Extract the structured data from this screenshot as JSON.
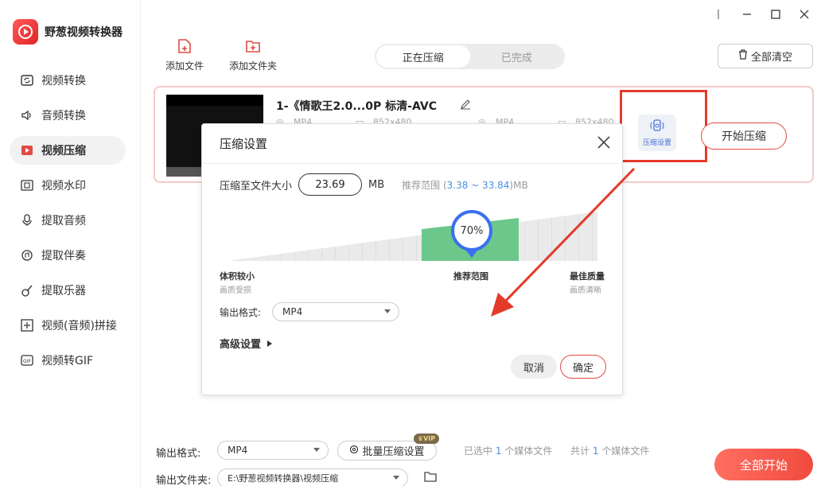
{
  "app": {
    "name": "野葱视频转换器"
  },
  "sidebar": {
    "items": [
      {
        "label": "视频转换",
        "icon": "video-convert-icon"
      },
      {
        "label": "音频转换",
        "icon": "audio-convert-icon"
      },
      {
        "label": "视频压缩",
        "icon": "video-compress-icon",
        "active": true
      },
      {
        "label": "视频水印",
        "icon": "watermark-icon"
      },
      {
        "label": "提取音频",
        "icon": "extract-audio-icon"
      },
      {
        "label": "提取伴奏",
        "icon": "extract-accompaniment-icon"
      },
      {
        "label": "提取乐器",
        "icon": "extract-instrument-icon"
      },
      {
        "label": "视频(音频)拼接",
        "icon": "merge-icon"
      },
      {
        "label": "视频转GIF",
        "icon": "gif-icon"
      }
    ]
  },
  "toolbar": {
    "add_file": "添加文件",
    "add_folder": "添加文件夹",
    "tabs": [
      "正在压缩",
      "已完成"
    ],
    "clear_all": "全部清空"
  },
  "file": {
    "name": "1-《情歌王2.0...0P 标清-AVC",
    "src_format": "MP4",
    "src_resolution": "852x480",
    "dst_format": "MP4",
    "dst_resolution": "852x480",
    "settings_label": "压缩设置",
    "start_label": "开始压缩"
  },
  "dialog": {
    "title": "压缩设置",
    "size_label": "压缩至文件大小",
    "size_value": "23.69",
    "size_unit": "MB",
    "range_prefix": "推荐范围 (",
    "range_value": "3.38 ~ 33.84",
    "range_suffix": ")MB",
    "slider_percent": "70%",
    "slider_value": 0.7,
    "left_title": "体积较小",
    "left_sub": "画质受损",
    "mid_title": "推荐范围",
    "right_title": "最佳质量",
    "right_sub": "画质清晰",
    "format_label": "输出格式:",
    "format_value": "MP4",
    "advanced": "高级设置",
    "cancel": "取消",
    "ok": "确定"
  },
  "bottom": {
    "format_label": "输出格式:",
    "format_value": "MP4",
    "batch_label": "批量压缩设置",
    "vip": "VIP",
    "selected_prefix": "已选中",
    "selected_count": "1",
    "selected_suffix": "个媒体文件",
    "total_prefix": "共计",
    "total_count": "1",
    "total_suffix": "个媒体文件",
    "folder_label": "输出文件夹:",
    "folder_value": "E:\\野葱视频转换器\\视频压缩",
    "start_all": "全部开始"
  },
  "colors": {
    "accent": "#e04b43",
    "blue": "#3a6ff0",
    "green": "#6cc88a"
  }
}
